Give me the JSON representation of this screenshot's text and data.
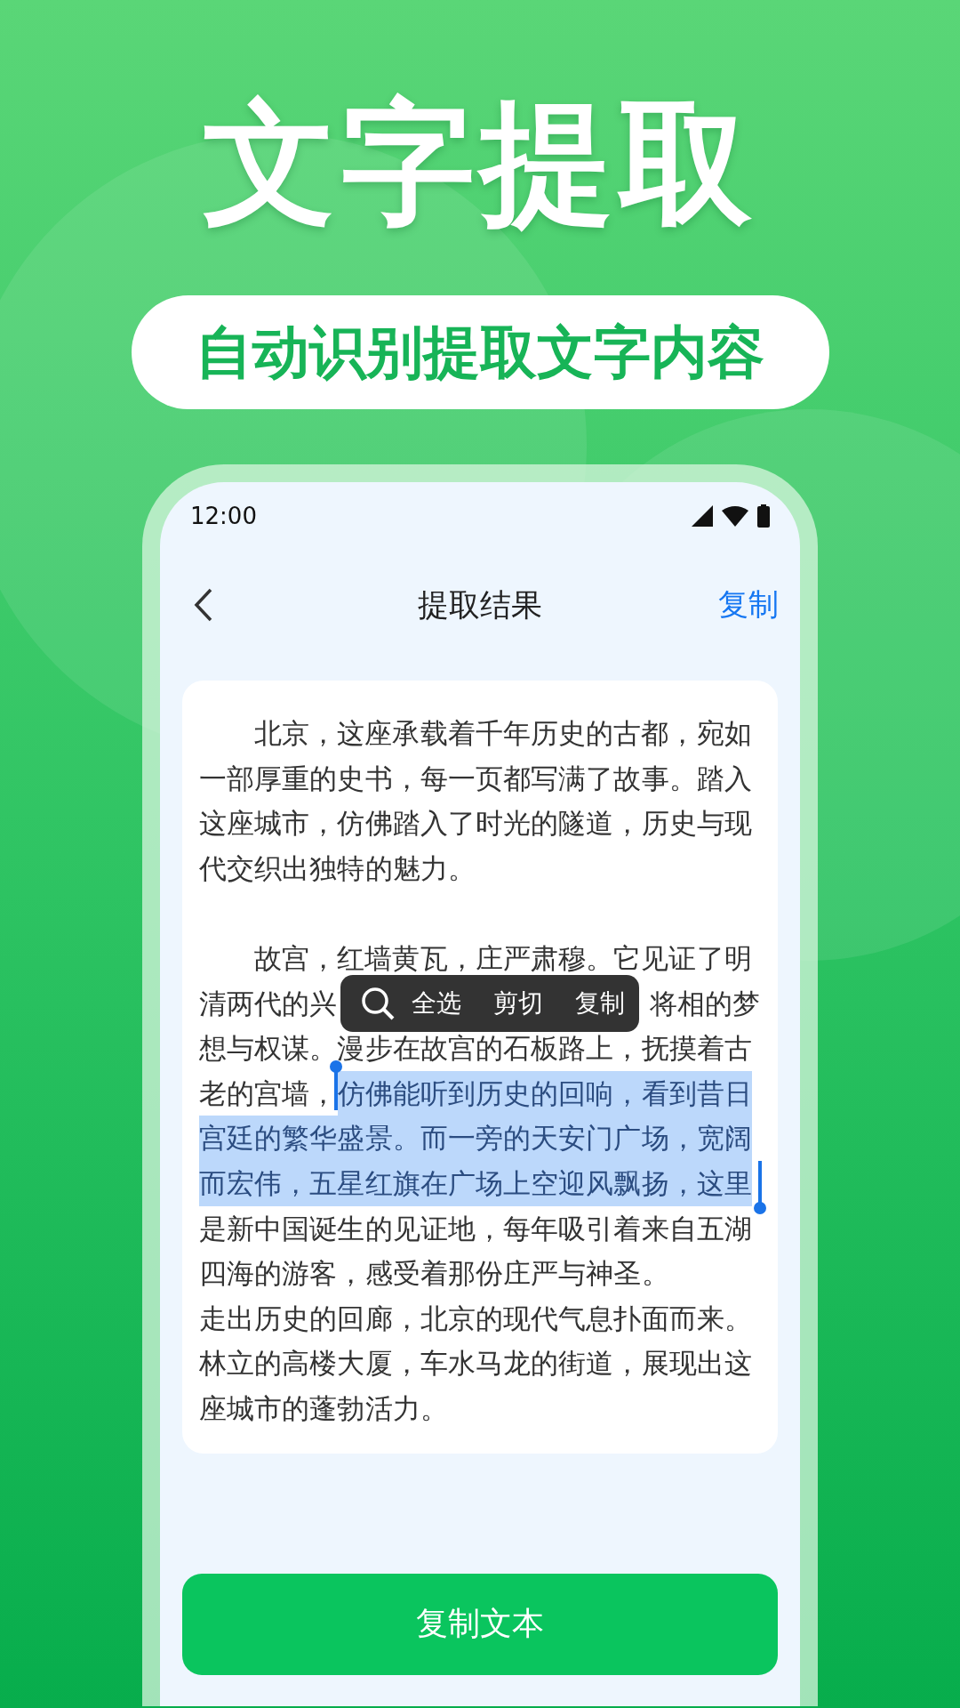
{
  "headline": "文字提取",
  "subtitle": "自动识别提取文字内容",
  "status_bar": {
    "time": "12:00"
  },
  "nav": {
    "title": "提取结果",
    "action": "复制"
  },
  "text_card": {
    "lines": [
      {
        "indent": true,
        "kind": "plain",
        "segments": [
          {
            "text": "北京，这座承载着千年历史的古都，宛如",
            "selected": false
          }
        ]
      },
      {
        "indent": false,
        "kind": "plain",
        "segments": [
          {
            "text": "一部厚重的史书，每一页都写满了故事。踏入",
            "selected": false
          }
        ]
      },
      {
        "indent": false,
        "kind": "plain",
        "segments": [
          {
            "text": "这座城市，仿佛踏入了时光的隧道，历史与现",
            "selected": false
          }
        ]
      },
      {
        "indent": false,
        "kind": "plain",
        "segments": [
          {
            "text": "代交织出独特的魅力。",
            "selected": false
          }
        ]
      },
      {
        "kind": "blank"
      },
      {
        "indent": true,
        "kind": "plain",
        "segments": [
          {
            "text": "故宫，红墙黄瓦，庄严肃穆。它见证了明",
            "selected": false
          }
        ]
      },
      {
        "indent": false,
        "kind": "split",
        "segments": [
          {
            "text": "清两代的兴",
            "selected": false
          },
          {
            "text": "将相的梦",
            "selected": false
          }
        ]
      },
      {
        "indent": false,
        "kind": "plain",
        "segments": [
          {
            "text": "想与权谋。漫步在故宫的石板路上，抚摸着古",
            "selected": false
          }
        ]
      },
      {
        "indent": false,
        "kind": "plain",
        "segments": [
          {
            "text": "老的宫墙，",
            "selected": false
          },
          {
            "text": "仿佛能听到历史的回响，看到昔日",
            "selected": true
          }
        ]
      },
      {
        "indent": false,
        "kind": "plain",
        "segments": [
          {
            "text": "宫廷的繁华盛景。而一旁的天安门广场，宽阔",
            "selected": true
          }
        ]
      },
      {
        "indent": false,
        "kind": "plain",
        "segments": [
          {
            "text": "而宏伟，五星红旗在广场上空迎风飘扬，这里",
            "selected": true
          }
        ]
      },
      {
        "indent": false,
        "kind": "plain",
        "segments": [
          {
            "text": "是新中国诞生的见证地，每年吸引着来自五湖",
            "selected": false
          }
        ]
      },
      {
        "indent": false,
        "kind": "plain",
        "segments": [
          {
            "text": "四海的游客，感受着那份庄严与神圣。",
            "selected": false
          }
        ]
      },
      {
        "indent": false,
        "kind": "plain",
        "segments": [
          {
            "text": "走出历史的回廊，北京的现代气息扑面而来。",
            "selected": false
          }
        ]
      },
      {
        "indent": false,
        "kind": "plain",
        "segments": [
          {
            "text": "林立的高楼大厦，车水马龙的街道，展现出这",
            "selected": false
          }
        ]
      },
      {
        "indent": false,
        "kind": "plain",
        "segments": [
          {
            "text": "座城市的蓬勃活力。",
            "selected": false
          }
        ]
      }
    ]
  },
  "context_menu": {
    "items": [
      "全选",
      "剪切",
      "复制"
    ]
  },
  "primary_button": "复制文本"
}
